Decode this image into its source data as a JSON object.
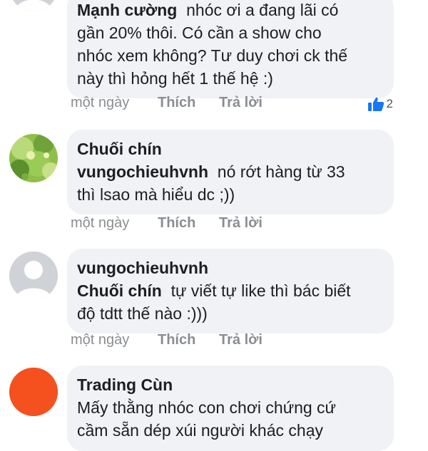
{
  "comments": [
    {
      "author": "Mạnh cường",
      "text_lines": [
        "nhóc ơi a đang lãi có",
        "gần 20% thôi. Có cần a show cho",
        "nhóc xem không? Tư duy chơi ck thế",
        "này thì hỏng hết 1 thế hệ :)"
      ],
      "time": "một ngày",
      "like_label": "Thích",
      "reply_label": "Trả lời",
      "reaction_count": "2"
    },
    {
      "author": "Chuối chín",
      "mention": "vungochieuhvnh",
      "text_first": "nó rớt hàng từ 33",
      "text_rest": "thì lsao mà hiểu dc ;))",
      "time": "một ngày",
      "like_label": "Thích",
      "reply_label": "Trả lời"
    },
    {
      "author": "vungochieuhvnh",
      "mention": "Chuối chín",
      "text_first": "tự viết tự like thì bác biết",
      "text_rest": "độ tdtt thế nào :)))",
      "time": "một ngày",
      "like_label": "Thích",
      "reply_label": "Trả lời"
    },
    {
      "author": "Trading Cùn",
      "text_lines": [
        "Mấy thằng nhóc con chơi chứng cứ",
        "cầm sẵn dép xúi người khác chạy"
      ]
    }
  ],
  "colors": {
    "bubble": "#f0f2f5",
    "meta_text": "#8a8d91",
    "like_blue": "#1877f2",
    "avatar_orange": "#f4511e"
  }
}
